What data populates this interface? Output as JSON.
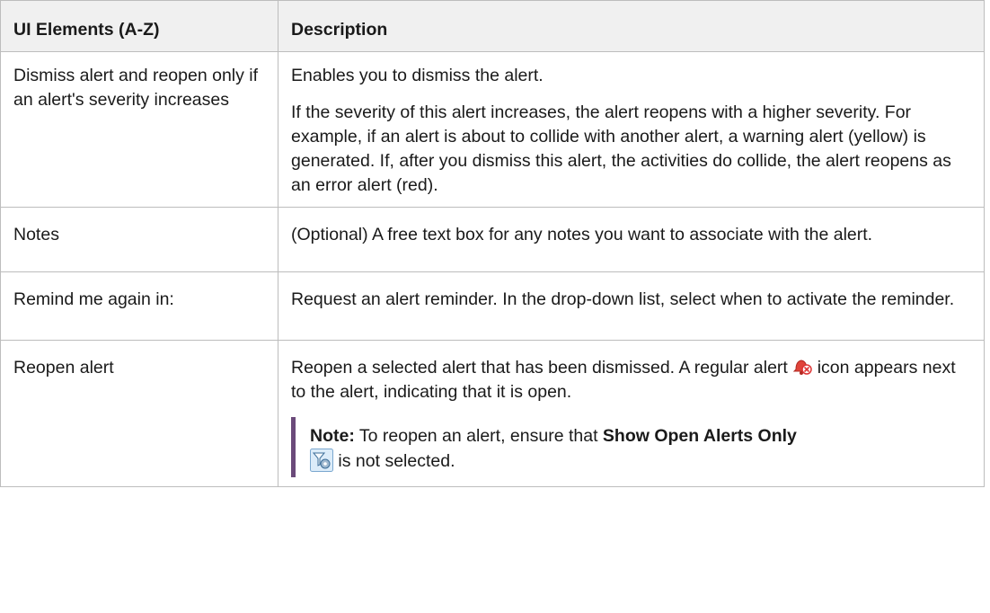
{
  "table": {
    "headers": [
      "UI Elements (A-Z)",
      "Description"
    ],
    "rows": [
      {
        "element": "Dismiss alert and reopen only if an alert's severity increases",
        "p1": "Enables you to dismiss the alert.",
        "p2": "If the severity of this alert increases, the alert reopens with a higher severity. For example, if an alert is about to collide with another alert, a warning alert (yellow) is generated. If, after you dismiss this alert, the activities do collide, the alert reopens as an error alert (red)."
      },
      {
        "element": "Notes",
        "p1": "(Optional) A free text box for any notes you want to associate with the alert."
      },
      {
        "element": "Remind me again in:",
        "p1": "Request an alert reminder. In the drop-down list, select when to activate the reminder."
      },
      {
        "element": "Reopen alert",
        "p1_before_icon": "Reopen a selected alert that has been dismissed. A regular alert",
        "p1_after_icon": "icon appears next to the alert, indicating that it is open.",
        "note_label": "Note:",
        "note_text_1": "To reopen an alert, ensure that",
        "note_bold": "Show Open Alerts Only",
        "note_text_2": "is not selected."
      }
    ]
  },
  "icons": {
    "alert_icon": "alert-bell-icon",
    "filter_icon": "show-open-alerts-filter-icon"
  },
  "colors": {
    "header_bg": "#f0f0f0",
    "border": "#bdbdbd",
    "note_bar": "#6b4a7a",
    "alert_red": "#e0443a"
  }
}
